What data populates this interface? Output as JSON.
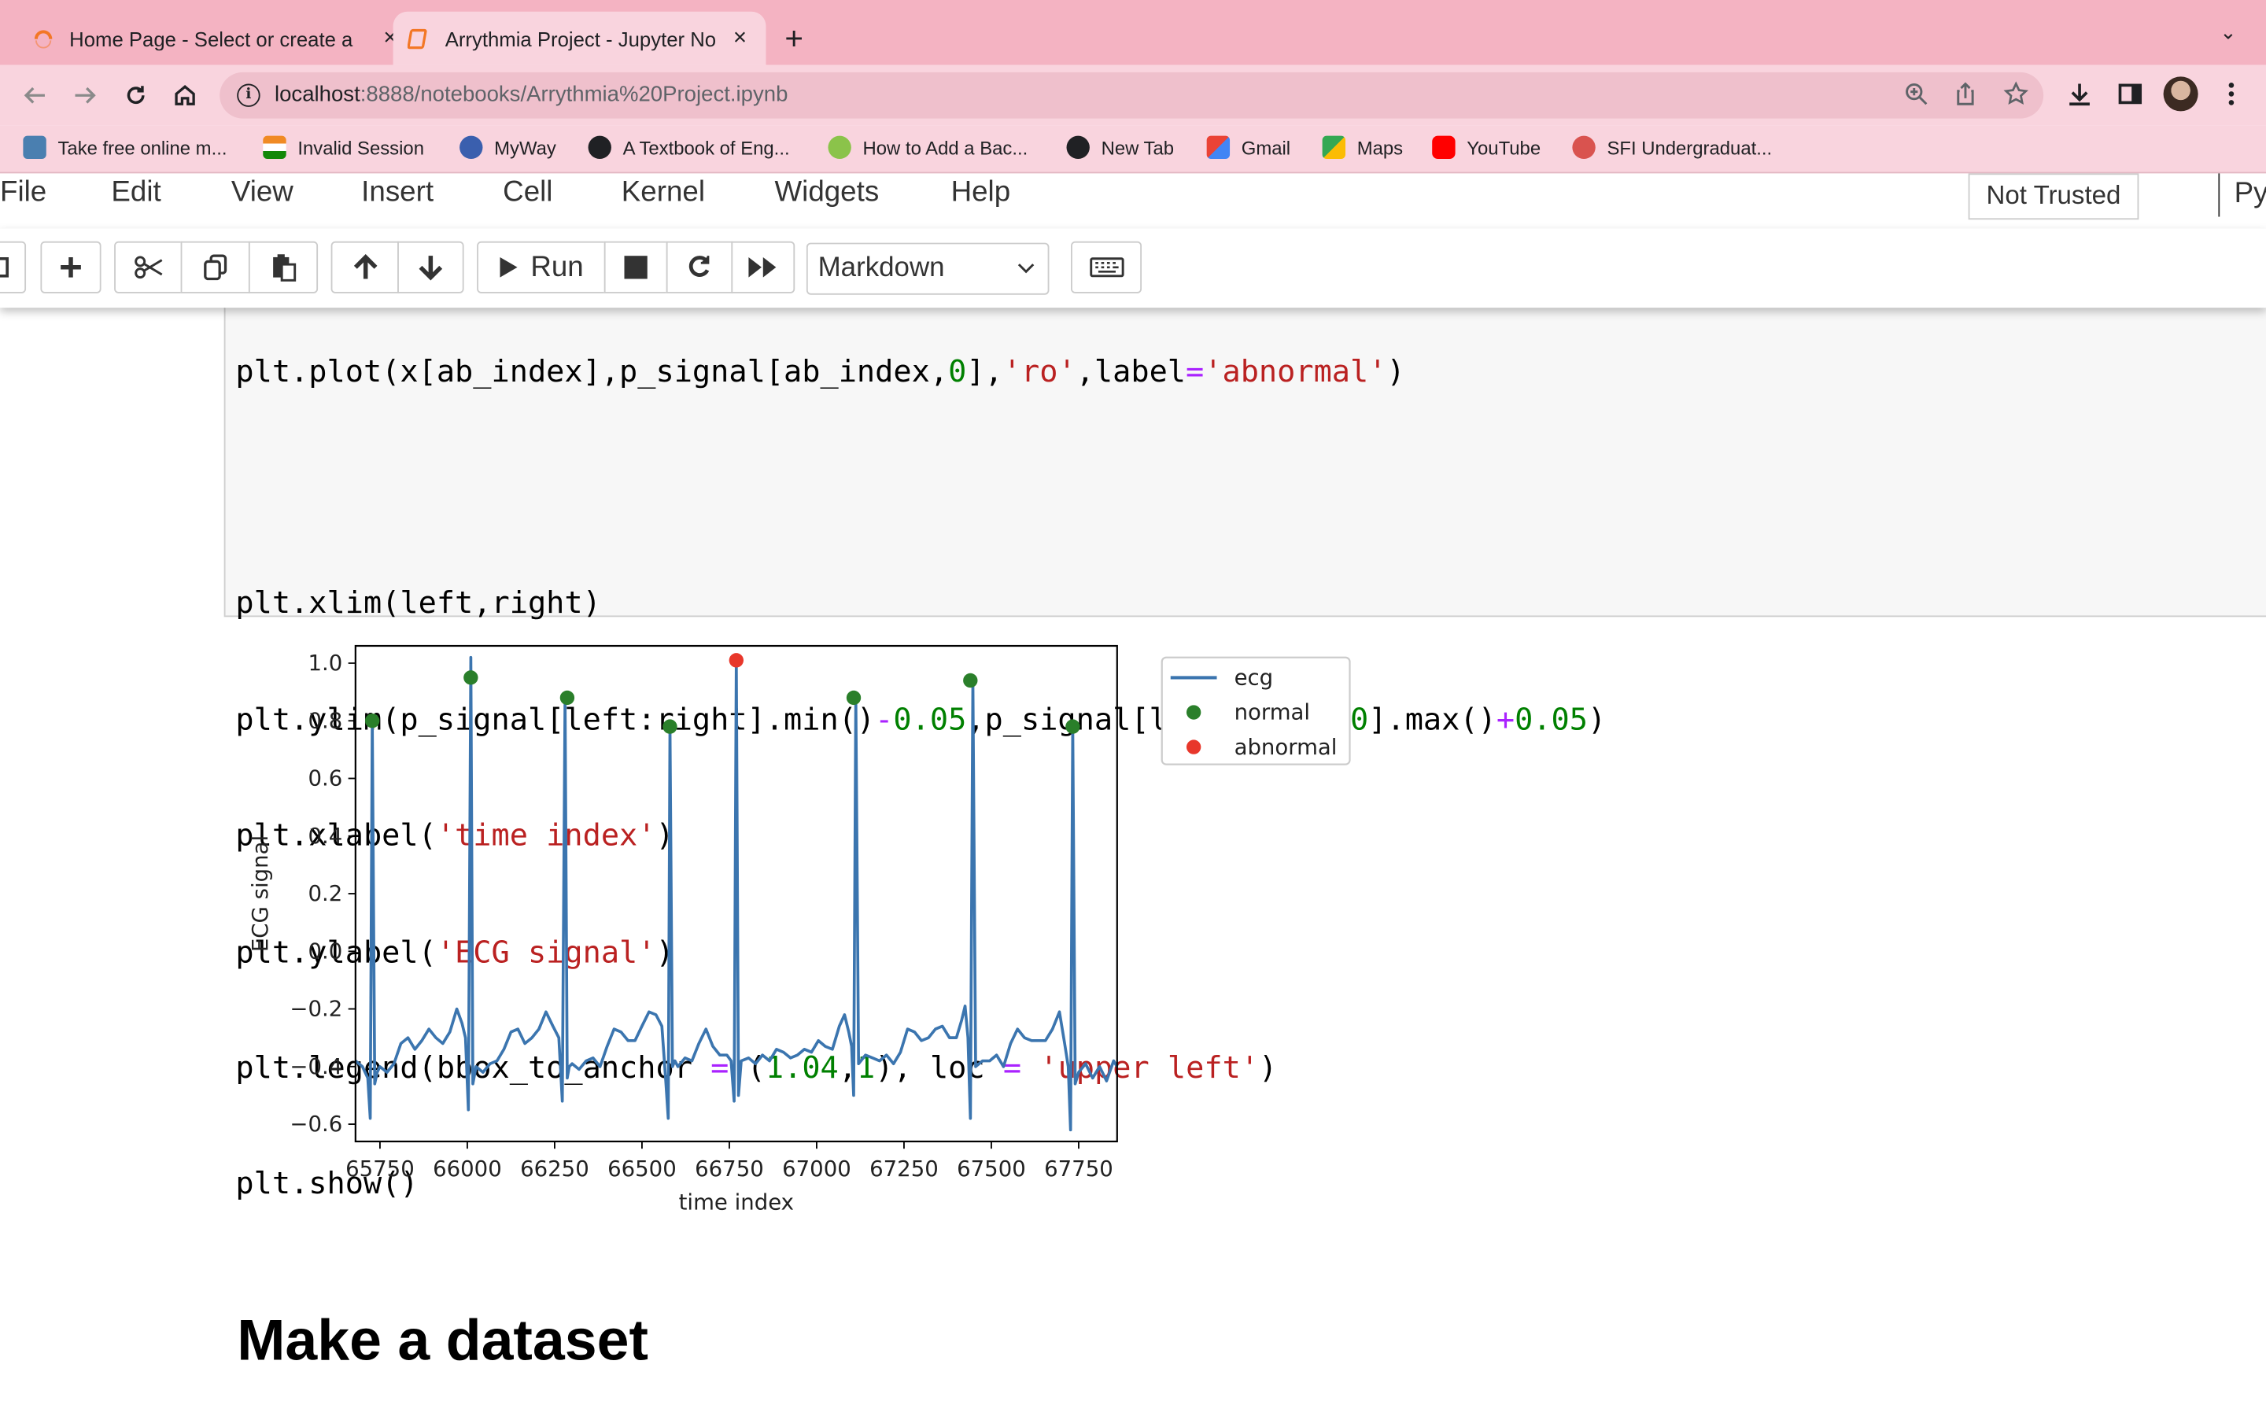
{
  "browser": {
    "tabs": [
      {
        "title": "Home Page - Select or create a",
        "close": "×"
      },
      {
        "title": "Arrythmia Project - Jupyter No",
        "close": "×"
      }
    ],
    "new_tab": "+",
    "tab_menu": "⌄",
    "url_host": "localhost",
    "url_rest": ":8888/notebooks/Arrythmia%20Project.ipynb",
    "bookmarks": [
      {
        "label": "Take free online m...",
        "icon_color": "#4a7fb0"
      },
      {
        "label": "Invalid Session",
        "icon_color": "#f08a24"
      },
      {
        "label": "MyWay",
        "icon_color": "#3a5fae"
      },
      {
        "label": "A Textbook of Eng...",
        "icon_color": "#202124"
      },
      {
        "label": "How to Add a Bac...",
        "icon_color": "#8bc34a"
      },
      {
        "label": "New Tab",
        "icon_color": "#202124"
      },
      {
        "label": "Gmail",
        "icon_color": "#ea4335"
      },
      {
        "label": "Maps",
        "icon_color": "#34a853"
      },
      {
        "label": "YouTube",
        "icon_color": "#ff0000"
      },
      {
        "label": "SFI Undergraduat...",
        "icon_color": "#d9534f"
      }
    ]
  },
  "jupyter": {
    "menu": [
      "File",
      "Edit",
      "View",
      "Insert",
      "Cell",
      "Kernel",
      "Widgets",
      "Help"
    ],
    "trusted": "Not Trusted",
    "kernel": "Py",
    "run_label": "Run",
    "cell_type": "Markdown"
  },
  "code_lines": [
    "plt.plot(x[ab_index],p_signal[ab_index,0],'ro',label='abnormal')",
    "",
    "plt.xlim(left,right)",
    "plt.ylim(p_signal[left:right].min()-0.05,p_signal[left:right,0].max()+0.05)",
    "plt.xlabel('time index')",
    "plt.ylabel('ECG signal')",
    "plt.legend(bbox_to_anchor = (1.04,1), loc = 'upper left')",
    "plt.show()"
  ],
  "chart_data": {
    "type": "line",
    "xlabel": "time index",
    "ylabel": "ECG signal",
    "xlim": [
      65680,
      67860
    ],
    "ylim": [
      -0.66,
      1.06
    ],
    "xticks": [
      65750,
      66000,
      66250,
      66500,
      66750,
      67000,
      67250,
      67500,
      67750
    ],
    "xtick_labels": [
      "65750",
      "66000",
      "66250",
      "66500",
      "66750",
      "67000",
      "67250",
      "67500",
      "67750"
    ],
    "yticks": [
      1.0,
      0.8,
      0.6,
      0.4,
      0.2,
      0.0,
      -0.2,
      -0.4,
      -0.6
    ],
    "ytick_labels": [
      "1.0",
      "0.8",
      "0.6",
      "0.4",
      "0.2",
      "0.0",
      "−0.2",
      "−0.4",
      "−0.6"
    ],
    "legend_position": "outside upper-left",
    "series": [
      {
        "name": "ecg",
        "color": "#3b75af",
        "x": [
          65680,
          65700,
          65715,
          65722,
          65728,
          65735,
          65742,
          65750,
          65770,
          65790,
          65810,
          65830,
          65850,
          65870,
          65890,
          65910,
          65930,
          65950,
          65970,
          65985,
          65995,
          66003,
          66010,
          66016,
          66025,
          66045,
          66065,
          66085,
          66105,
          66125,
          66145,
          66165,
          66185,
          66205,
          66225,
          66245,
          66262,
          66272,
          66280,
          66286,
          66292,
          66300,
          66320,
          66340,
          66360,
          66380,
          66400,
          66420,
          66440,
          66460,
          66480,
          66500,
          66520,
          66540,
          66557,
          66568,
          66575,
          66580,
          66587,
          66594,
          66603,
          66623,
          66643,
          66663,
          66683,
          66703,
          66723,
          66743,
          66755,
          66764,
          66770,
          66776,
          66784,
          66805,
          66825,
          66845,
          66865,
          66885,
          66905,
          66925,
          66945,
          66965,
          66985,
          67005,
          67025,
          67045,
          67065,
          67080,
          67092,
          67100,
          67106,
          67112,
          67120,
          67140,
          67160,
          67180,
          67200,
          67220,
          67240,
          67260,
          67280,
          67300,
          67320,
          67340,
          67360,
          67380,
          67400,
          67415,
          67425,
          67433,
          67440,
          67447,
          67455,
          67475,
          67495,
          67515,
          67535,
          67555,
          67575,
          67595,
          67615,
          67635,
          67655,
          67675,
          67695,
          67710,
          67720,
          67727,
          67733,
          67740,
          67750,
          67770,
          67790,
          67810,
          67830,
          67850,
          67860
        ],
        "values": [
          -0.38,
          -0.4,
          -0.44,
          -0.58,
          0.8,
          -0.46,
          -0.42,
          -0.4,
          -0.42,
          -0.39,
          -0.32,
          -0.3,
          -0.34,
          -0.31,
          -0.27,
          -0.3,
          -0.32,
          -0.28,
          -0.2,
          -0.25,
          -0.3,
          -0.55,
          1.02,
          -0.46,
          -0.4,
          -0.42,
          -0.39,
          -0.38,
          -0.34,
          -0.28,
          -0.27,
          -0.32,
          -0.3,
          -0.27,
          -0.21,
          -0.26,
          -0.3,
          -0.52,
          0.88,
          -0.44,
          -0.4,
          -0.39,
          -0.41,
          -0.38,
          -0.37,
          -0.4,
          -0.33,
          -0.27,
          -0.28,
          -0.31,
          -0.31,
          -0.26,
          -0.21,
          -0.22,
          -0.26,
          -0.45,
          -0.58,
          0.78,
          -0.4,
          -0.38,
          -0.4,
          -0.37,
          -0.38,
          -0.32,
          -0.27,
          -0.33,
          -0.36,
          -0.36,
          -0.38,
          -0.52,
          1.01,
          -0.5,
          -0.38,
          -0.37,
          -0.39,
          -0.36,
          -0.38,
          -0.34,
          -0.35,
          -0.37,
          -0.36,
          -0.34,
          -0.35,
          -0.31,
          -0.33,
          -0.34,
          -0.26,
          -0.22,
          -0.28,
          -0.33,
          -0.5,
          0.88,
          -0.39,
          -0.36,
          -0.37,
          -0.38,
          -0.36,
          -0.39,
          -0.35,
          -0.27,
          -0.28,
          -0.31,
          -0.3,
          -0.27,
          -0.26,
          -0.3,
          -0.3,
          -0.24,
          -0.19,
          -0.3,
          -0.58,
          0.94,
          -0.4,
          -0.38,
          -0.38,
          -0.36,
          -0.4,
          -0.32,
          -0.27,
          -0.3,
          -0.31,
          -0.31,
          -0.31,
          -0.27,
          -0.21,
          -0.32,
          -0.4,
          -0.62,
          0.78,
          -0.46,
          -0.42,
          -0.39,
          -0.44,
          -0.4,
          -0.45,
          -0.38,
          -0.4
        ]
      },
      {
        "name": "normal",
        "color": "#2a7f2a",
        "x": [
          65728,
          66010,
          66286,
          66580,
          67106,
          67440,
          67733
        ],
        "values": [
          0.8,
          0.95,
          0.88,
          0.78,
          0.88,
          0.94,
          0.78
        ]
      },
      {
        "name": "abnormal",
        "color": "#e8372b",
        "x": [
          66770
        ],
        "values": [
          1.01
        ]
      }
    ]
  },
  "heading": "Make a dataset"
}
